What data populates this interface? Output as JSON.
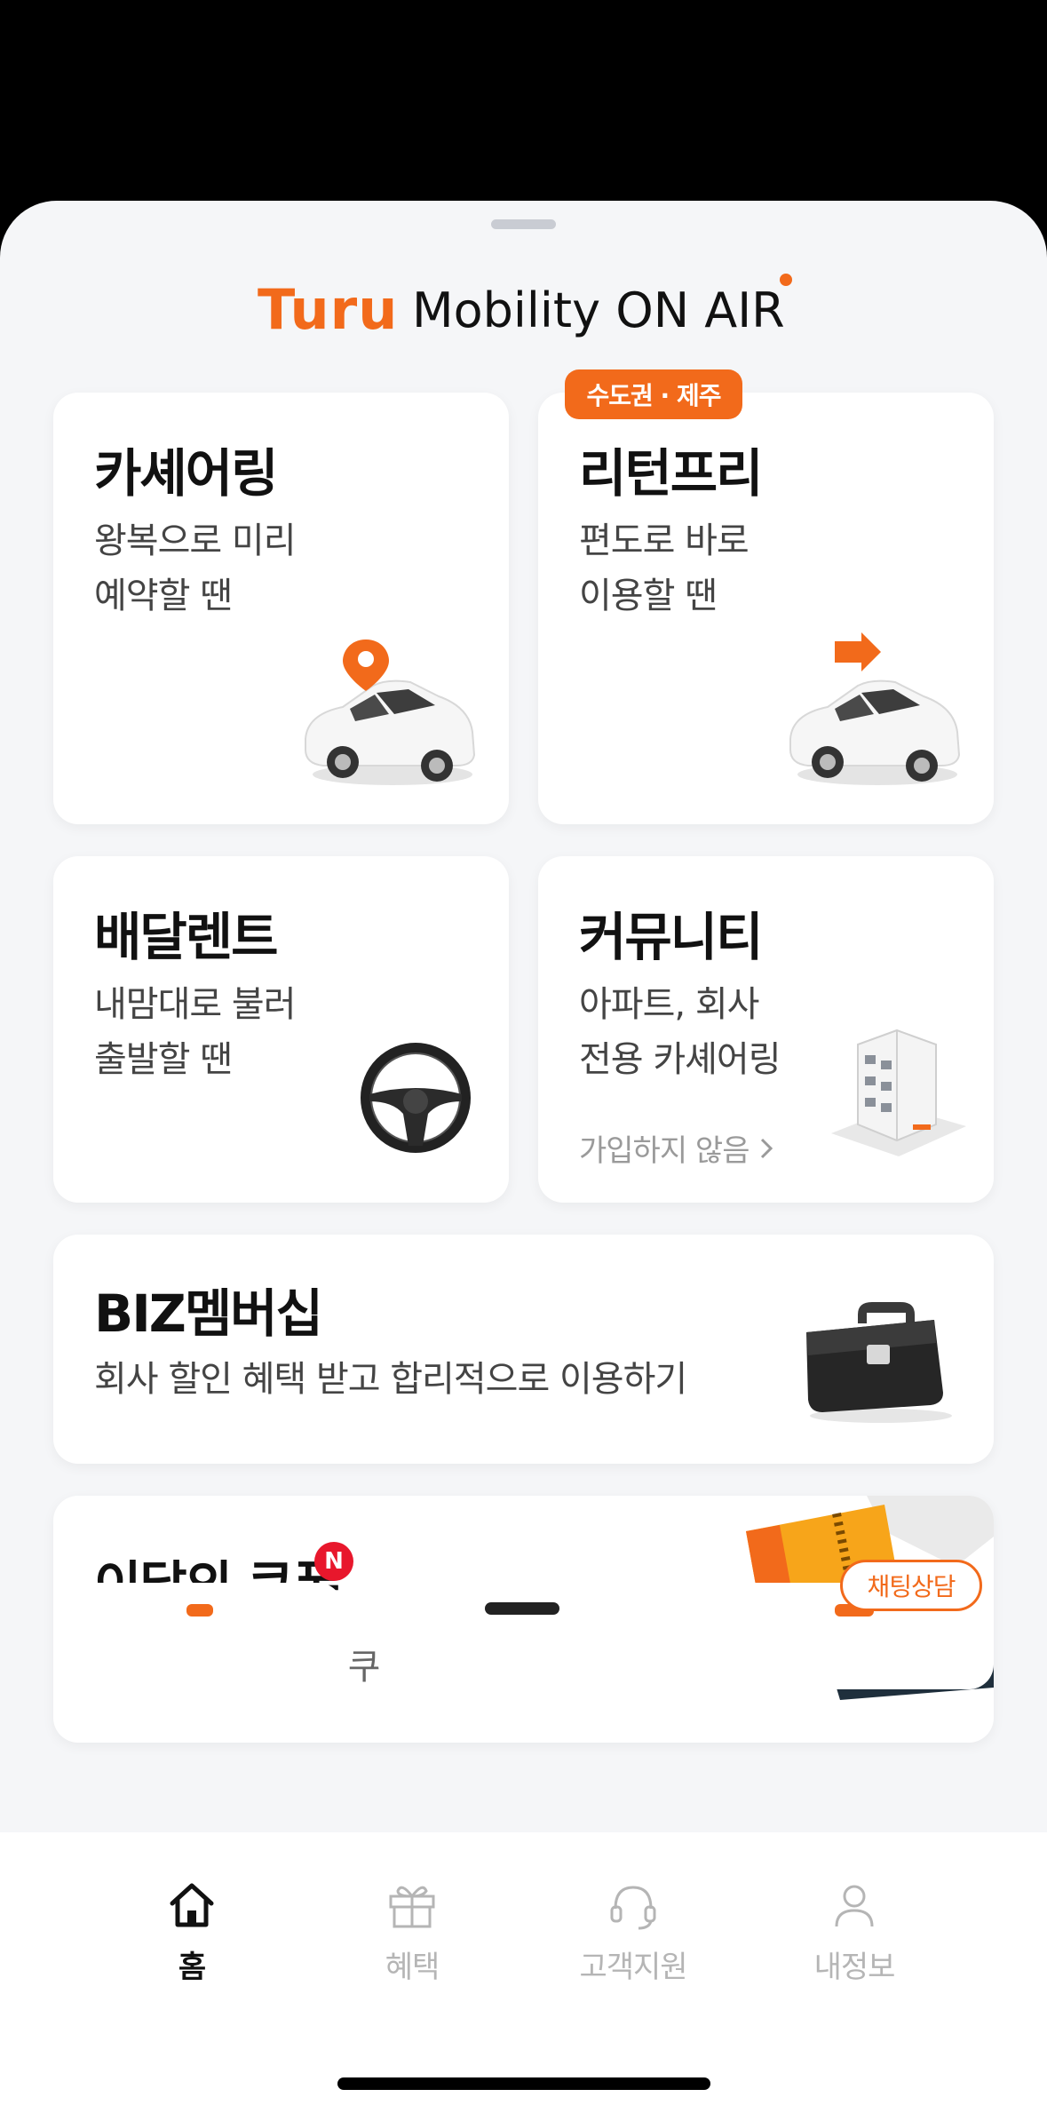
{
  "header": {
    "logo_brand": "Turu",
    "logo_tagline": "Mobility ON AIR"
  },
  "cards": {
    "carsharing": {
      "title": "카셰어링",
      "line1": "왕복으로 미리",
      "line2": "예약할 땐"
    },
    "returnfree": {
      "badge": "수도권 · 제주",
      "title": "리턴프리",
      "line1": "편도로 바로",
      "line2": "이용할 땐"
    },
    "delivery": {
      "title": "배달렌트",
      "line1": "내맘대로 불러",
      "line2": "출발할 땐"
    },
    "community": {
      "title": "커뮤니티",
      "line1": "아파트, 회사",
      "line2": "전용 카셰어링",
      "link": "가입하지 않음"
    },
    "biz": {
      "title": "BIZ멤버십",
      "subtitle": "회사 할인 혜택 받고 합리적으로 이용하기"
    },
    "coupon": {
      "title": "이달의 쿠폰",
      "new_badge": "N",
      "subtitle": "매달 새로운 할인 쿠폰 적극 활용하기!"
    }
  },
  "chat_button": "채팅상담",
  "tabbar": {
    "tabs": [
      {
        "label": "홈",
        "icon": "home-icon",
        "active": true
      },
      {
        "label": "혜택",
        "icon": "gift-icon",
        "active": false
      },
      {
        "label": "고객지원",
        "icon": "headset-icon",
        "active": false
      },
      {
        "label": "내정보",
        "icon": "person-icon",
        "active": false
      }
    ]
  },
  "colors": {
    "accent": "#f26a1b",
    "background": "#f5f6f8",
    "new_badge": "#e8172c"
  }
}
